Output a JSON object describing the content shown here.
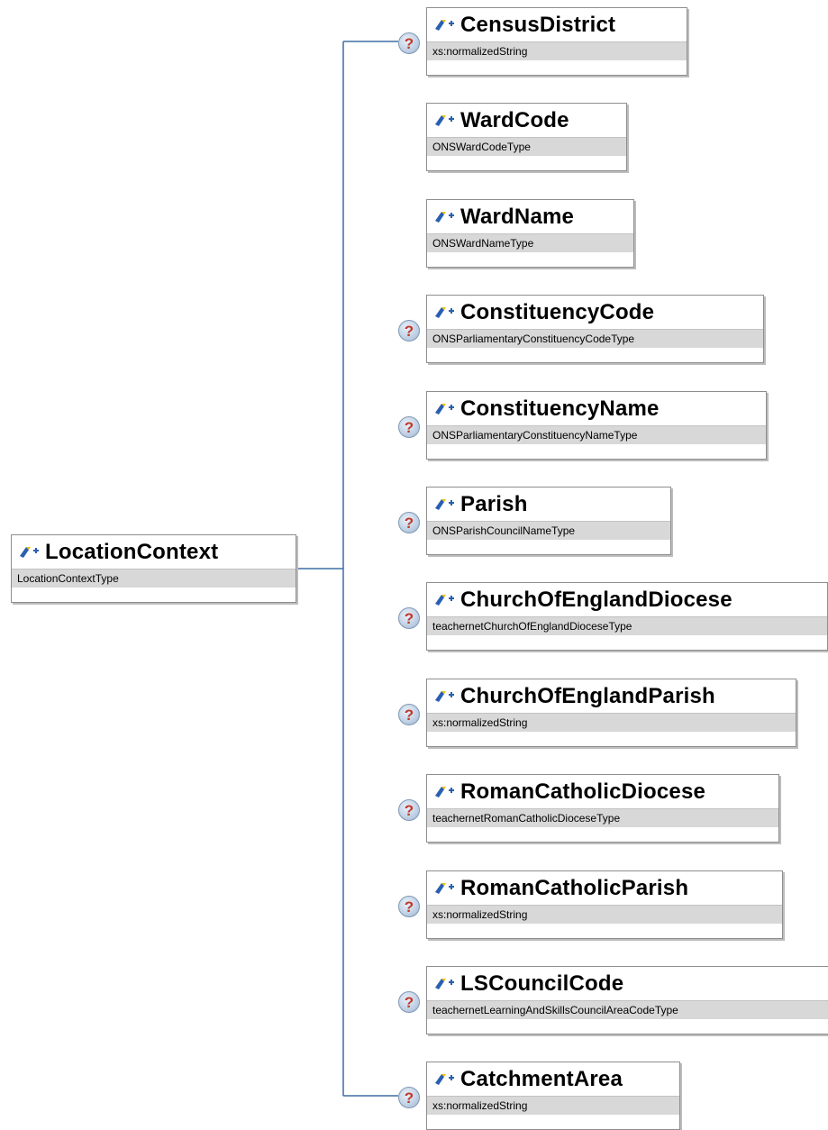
{
  "root": {
    "name": "LocationContext",
    "type": "LocationContextType",
    "icon": "element-icon"
  },
  "children": [
    {
      "name": "CensusDistrict",
      "type": "xs:normalizedString",
      "optional": true
    },
    {
      "name": "WardCode",
      "type": "ONSWardCodeType",
      "optional": false
    },
    {
      "name": "WardName",
      "type": "ONSWardNameType",
      "optional": false
    },
    {
      "name": "ConstituencyCode",
      "type": "ONSParliamentaryConstituencyCodeType",
      "optional": true
    },
    {
      "name": "ConstituencyName",
      "type": "ONSParliamentaryConstituencyNameType",
      "optional": true
    },
    {
      "name": "Parish",
      "type": "ONSParishCouncilNameType",
      "optional": true
    },
    {
      "name": "ChurchOfEnglandDiocese",
      "type": "teachernetChurchOfEnglandDioceseType",
      "optional": true
    },
    {
      "name": "ChurchOfEnglandParish",
      "type": "xs:normalizedString",
      "optional": true
    },
    {
      "name": "RomanCatholicDiocese",
      "type": "teachernetRomanCatholicDioceseType",
      "optional": true
    },
    {
      "name": "RomanCatholicParish",
      "type": "xs:normalizedString",
      "optional": true
    },
    {
      "name": "LSCouncilCode",
      "type": "teachernetLearningAndSkillsCouncilAreaCodeType",
      "optional": true
    },
    {
      "name": "CatchmentArea",
      "type": "xs:normalizedString",
      "optional": true
    }
  ],
  "optional_marker": "?",
  "colors": {
    "connector": "#3f6ea6",
    "type_band": "#d8d8d8",
    "border": "#8e8e8e",
    "optional_mark": "#c0392b"
  }
}
